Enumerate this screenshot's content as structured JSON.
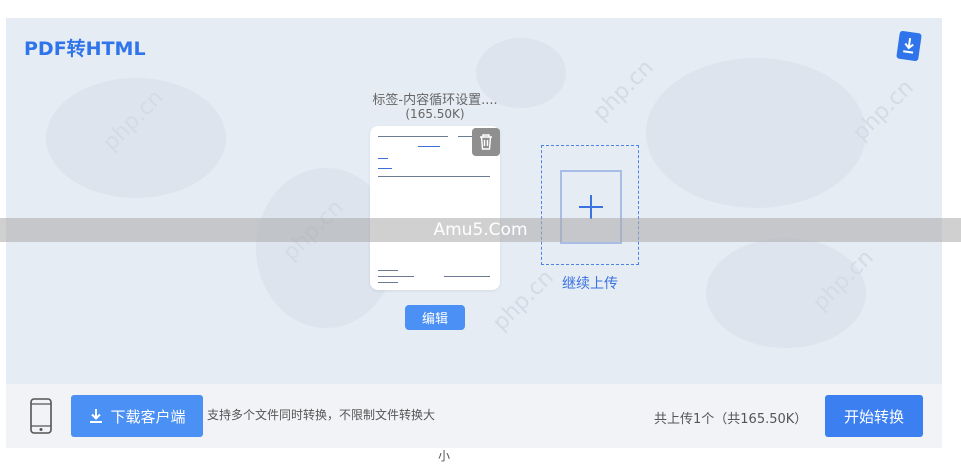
{
  "header": {
    "title": "PDF转HTML"
  },
  "file": {
    "name": "标签-内容循环设置....",
    "size": "(165.50K)",
    "edit_label": "编辑"
  },
  "upload": {
    "continue_label": "继续上传"
  },
  "overlay_watermark": "Amu5.Com",
  "background_watermark": "php.cn",
  "footer": {
    "download_label": "下载客户端",
    "hint_line1": "支持多个文件同时转换，不限制文件转换大",
    "hint_line2": "小",
    "total": "共上传1个（共165.50K）",
    "start_label": "开始转换"
  },
  "colors": {
    "accent": "#4a90f5",
    "title": "#2f74ea",
    "panel_bg": "#e6ecf4"
  }
}
